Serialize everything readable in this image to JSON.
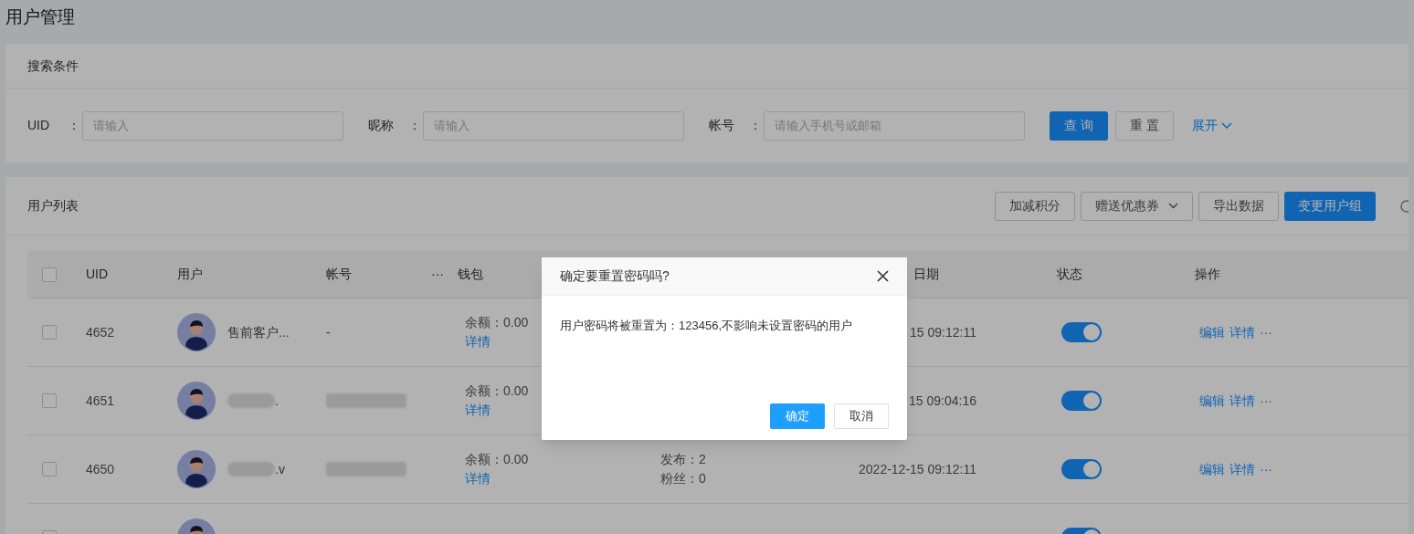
{
  "page_title": "用户管理",
  "search": {
    "title": "搜索条件",
    "fields": [
      {
        "label": "UID",
        "placeholder": "请输入"
      },
      {
        "label": "昵称",
        "placeholder": "请输入"
      },
      {
        "label": "帐号",
        "placeholder": "请输入手机号或邮箱"
      }
    ],
    "colon": "：",
    "buttons": [
      {
        "label": "查 询",
        "primary": true
      },
      {
        "label": "重 置",
        "primary": false
      }
    ],
    "expand": "展开"
  },
  "list": {
    "title": "用户列表",
    "actions": [
      {
        "label": "加减积分",
        "primary": false,
        "dropdown": false
      },
      {
        "label": "赠送优惠券",
        "primary": false,
        "dropdown": true
      },
      {
        "label": "导出数据",
        "primary": false,
        "dropdown": false
      },
      {
        "label": "变更用户组",
        "primary": true,
        "dropdown": false
      }
    ]
  },
  "table": {
    "header_checked": false,
    "columns": {
      "uid": "UID",
      "user": "用户",
      "account": "帐号",
      "account_more": "···",
      "wallet": "钱包",
      "date": "日期",
      "status": "状态",
      "actions": "操作"
    },
    "rows": [
      {
        "checked": false,
        "uid": "4652",
        "name": "售前客户...",
        "name_blurred": false,
        "account": "-",
        "account_blurred": false,
        "balance": "余额：0.00",
        "wallet_link": "详情",
        "stats": [],
        "date": "15 09:12:11",
        "on": true,
        "ops": [
          "编辑",
          "详情",
          "···"
        ]
      },
      {
        "checked": false,
        "uid": "4651",
        "name": ".",
        "name_blurred": true,
        "account_blurred": true,
        "balance": "余额：0.00",
        "wallet_link": "详情",
        "stats": [],
        "date": "15 09:04:16",
        "on": true,
        "ops": [
          "编辑",
          "详情",
          "···"
        ]
      },
      {
        "checked": false,
        "uid": "4650",
        "name": ".v",
        "name_blurred": true,
        "account_blurred": true,
        "balance": "余额：0.00",
        "wallet_link": "详情",
        "stats": [
          "发布：2",
          "粉丝：0"
        ],
        "date": "2022-12-15 09:12:11",
        "on": true,
        "ops": [
          "编辑",
          "详情",
          "···"
        ]
      },
      {
        "checked": false,
        "on": true
      }
    ]
  },
  "dialog": {
    "title": "确定要重置密码吗?",
    "message": "用户密码将被重置为：123456,不影响未设置密码的用户",
    "buttons": [
      {
        "label": "确定",
        "primary": true
      },
      {
        "label": "取消",
        "primary": false
      }
    ]
  }
}
